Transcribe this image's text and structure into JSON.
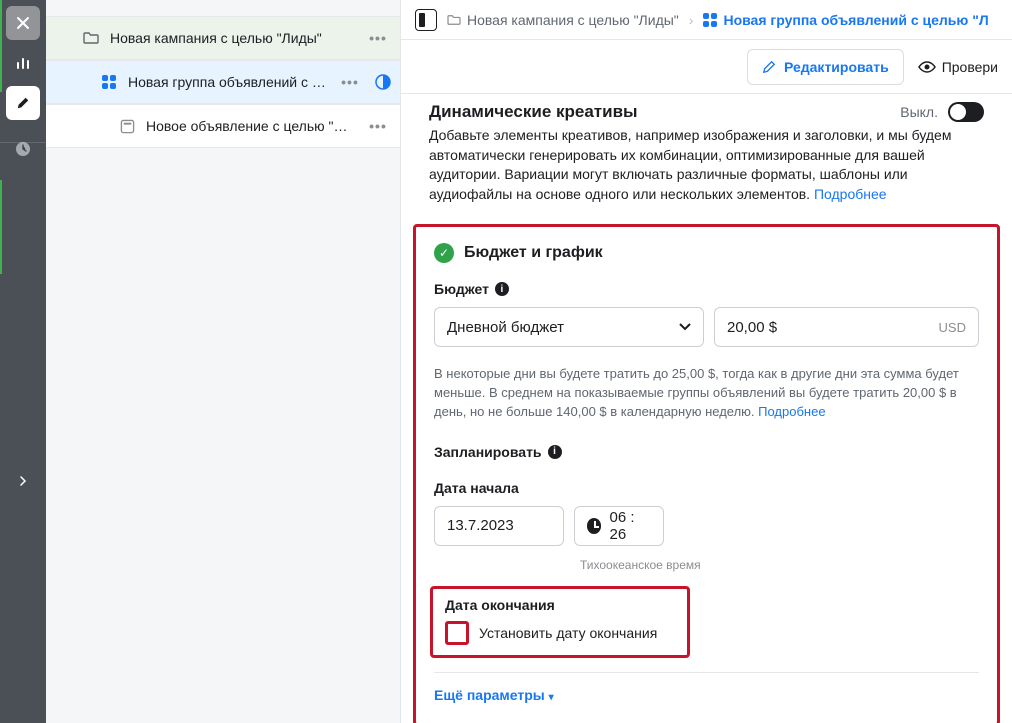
{
  "tree": {
    "campaign": "Новая кампания с целью \"Лиды\"",
    "adset": "Новая группа объявлений с це…",
    "ad": "Новое объявление с целью \"Лиды\""
  },
  "crumbs": {
    "campaign": "Новая кампания с целью \"Лиды\"",
    "adset": "Новая группа объявлений с целью \"Л"
  },
  "actions": {
    "edit": "Редактировать",
    "review": "Провери"
  },
  "dynamic": {
    "title": "Динамические креативы",
    "off": "Выкл.",
    "desc": "Добавьте элементы креативов, например изображения и заголовки, и мы будем автоматически генерировать их комбинации, оптимизированные для вашей аудитории. Вариации могут включать различные форматы, шаблоны или аудиофайлы на основе одного или нескольких элементов. ",
    "learn": "Подробнее"
  },
  "budget": {
    "heading": "Бюджет и график",
    "label": "Бюджет",
    "type": "Дневной бюджет",
    "amount": "20,00 $",
    "currency": "USD",
    "help_prefix": "В некоторые дни вы будете тратить до 25,00 $, тогда как в другие дни эта сумма будет меньше. В среднем на показываемые группы объявлений вы будете тратить 20,00 $ в день, но не больше 140,00 $ в календарную неделю. ",
    "learn": "Подробнее"
  },
  "schedule": {
    "label": "Запланировать",
    "start_label": "Дата начала",
    "start_date": "13.7.2023",
    "start_time": "06 : 26",
    "tz": "Тихоокеанское время",
    "end_label": "Дата окончания",
    "end_set": "Установить дату окончания"
  },
  "more": "Ещё параметры"
}
